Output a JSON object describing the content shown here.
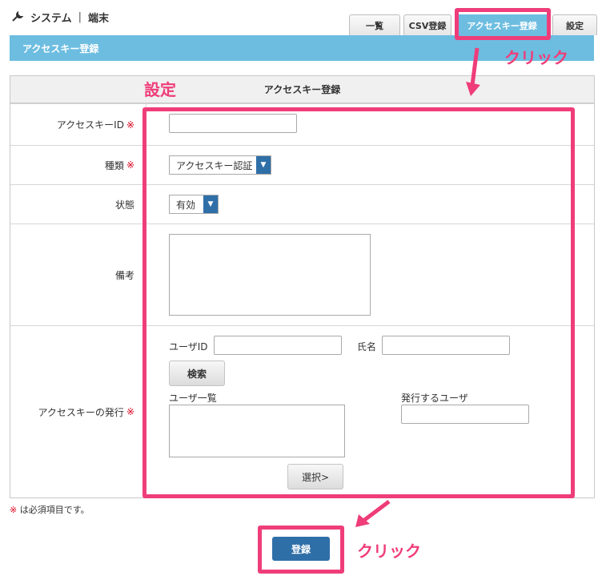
{
  "breadcrumb": {
    "section": "システム",
    "separator": "|",
    "page": "端末"
  },
  "tabs": [
    "一覧",
    "CSV登録",
    "アクセスキー登録",
    "設定"
  ],
  "title_bar": "アクセスキー登録",
  "form": {
    "header": "アクセスキー登録",
    "required_mark": "※",
    "access_key_id": {
      "label": "アクセスキーID",
      "value": ""
    },
    "type": {
      "label": "種類",
      "selected": "アクセスキー認証"
    },
    "status": {
      "label": "状態",
      "selected": "有効"
    },
    "remarks": {
      "label": "備考",
      "value": ""
    },
    "issue": {
      "label": "アクセスキーの発行",
      "user_id_label": "ユーザID",
      "name_label": "氏名",
      "search_button": "検索",
      "user_list_label": "ユーザ一覧",
      "issue_user_label": "発行するユーザ",
      "select_button": "選択>"
    }
  },
  "note": "は必須項目です。",
  "submit_button": "登録",
  "annotations": {
    "click1": "クリック",
    "settings": "設定",
    "click2": "クリック",
    "accent_color": "#ef3d7a"
  },
  "colors": {
    "header_blue": "#6dbde0",
    "button_blue": "#2f6fa8",
    "required_red": "#d9001b"
  }
}
